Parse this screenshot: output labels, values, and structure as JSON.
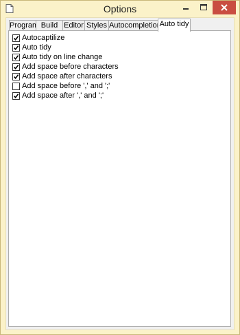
{
  "window": {
    "title": "Options"
  },
  "tabs": [
    {
      "label": "Program"
    },
    {
      "label": "Build"
    },
    {
      "label": "Editor"
    },
    {
      "label": "Styles"
    },
    {
      "label": "Autocompletion"
    },
    {
      "label": "Auto tidy",
      "active": true
    }
  ],
  "options": [
    {
      "label": "Autocaptilize",
      "checked": true
    },
    {
      "label": "Auto tidy",
      "checked": true
    },
    {
      "label": "Auto tidy on line change",
      "checked": true
    },
    {
      "label": "Add space before characters",
      "checked": true
    },
    {
      "label": "Add space after characters",
      "checked": true
    },
    {
      "label": "Add space before ',' and ';'",
      "checked": false
    },
    {
      "label": "Add space after ',' and ';'",
      "checked": true
    }
  ],
  "colors": {
    "frame": "#fbf2c9",
    "close_button": "#c94d41"
  },
  "icons": {
    "app": "document-icon",
    "minimize": "minimize-icon",
    "maximize": "maximize-icon",
    "close": "close-icon",
    "check": "checkmark-icon"
  }
}
